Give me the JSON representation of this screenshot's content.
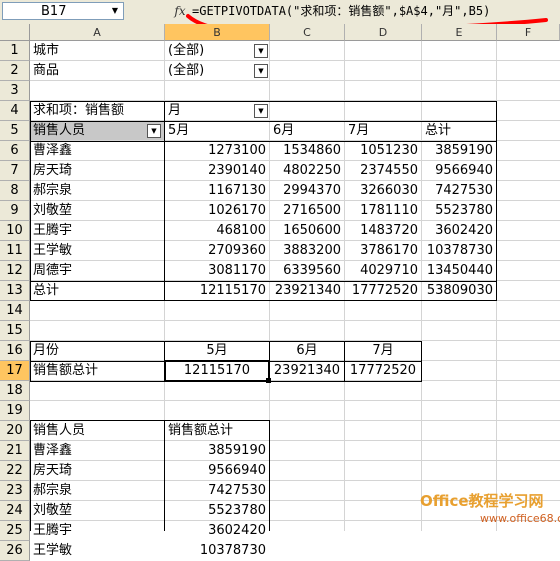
{
  "formula_bar": {
    "name_box": "B17",
    "fx_label": "fx",
    "formula": "=GETPIVOTDATA(\"求和项：销售额\",$A$4,\"月\",B5)"
  },
  "columns": [
    "A",
    "B",
    "C",
    "D",
    "E",
    "F"
  ],
  "selected_column": "B",
  "rows": [
    "1",
    "2",
    "3",
    "4",
    "5",
    "6",
    "7",
    "8",
    "9",
    "10",
    "11",
    "12",
    "13",
    "14",
    "15",
    "16",
    "17",
    "18",
    "19",
    "20",
    "21",
    "22",
    "23",
    "24",
    "25",
    "26"
  ],
  "selected_row": "17",
  "filters": [
    {
      "label": "城市",
      "value": "(全部)"
    },
    {
      "label": "商品",
      "value": "(全部)"
    }
  ],
  "pivot": {
    "data_field": "求和项：销售额",
    "col_field": "月",
    "row_field": "销售人员",
    "months": [
      "5月",
      "6月",
      "7月",
      "总计"
    ],
    "rows": [
      {
        "name": "曹泽鑫",
        "values": [
          "1273100",
          "1534860",
          "1051230",
          "3859190"
        ]
      },
      {
        "name": "房天琦",
        "values": [
          "2390140",
          "4802250",
          "2374550",
          "9566940"
        ]
      },
      {
        "name": "郝宗泉",
        "values": [
          "1167130",
          "2994370",
          "3266030",
          "7427530"
        ]
      },
      {
        "name": "刘敬堃",
        "values": [
          "1026170",
          "2716500",
          "1781110",
          "5523780"
        ]
      },
      {
        "name": "王腾宇",
        "values": [
          "468100",
          "1650600",
          "1483720",
          "3602420"
        ]
      },
      {
        "name": "王学敏",
        "values": [
          "2709360",
          "3883200",
          "3786170",
          "10378730"
        ]
      },
      {
        "name": "周德宇",
        "values": [
          "3081170",
          "6339560",
          "4029710",
          "13450440"
        ]
      }
    ],
    "total": {
      "name": "总计",
      "values": [
        "12115170",
        "23921340",
        "17772520",
        "53809030"
      ]
    }
  },
  "summary": {
    "row16_label": "月份",
    "months": [
      "5月",
      "6月",
      "7月"
    ],
    "row17_label": "销售额总计",
    "values": [
      "12115170",
      "23921340",
      "17772520"
    ]
  },
  "list": {
    "header_name": "销售人员",
    "header_value": "销售额总计",
    "rows": [
      {
        "name": "曹泽鑫",
        "value": "3859190"
      },
      {
        "name": "房天琦",
        "value": "9566940"
      },
      {
        "name": "郝宗泉",
        "value": "7427530"
      },
      {
        "name": "刘敬堃",
        "value": "5523780"
      },
      {
        "name": "王腾宇",
        "value": "3602420"
      },
      {
        "name": "王学敏",
        "value": "10378730"
      }
    ]
  },
  "watermark": {
    "line1": "Office教程学习网",
    "line2": "www.office68.com"
  },
  "colors": {
    "header_bg": "#ece9d8",
    "selected_header": "#ffc560",
    "red_mark": "#ff0000"
  }
}
